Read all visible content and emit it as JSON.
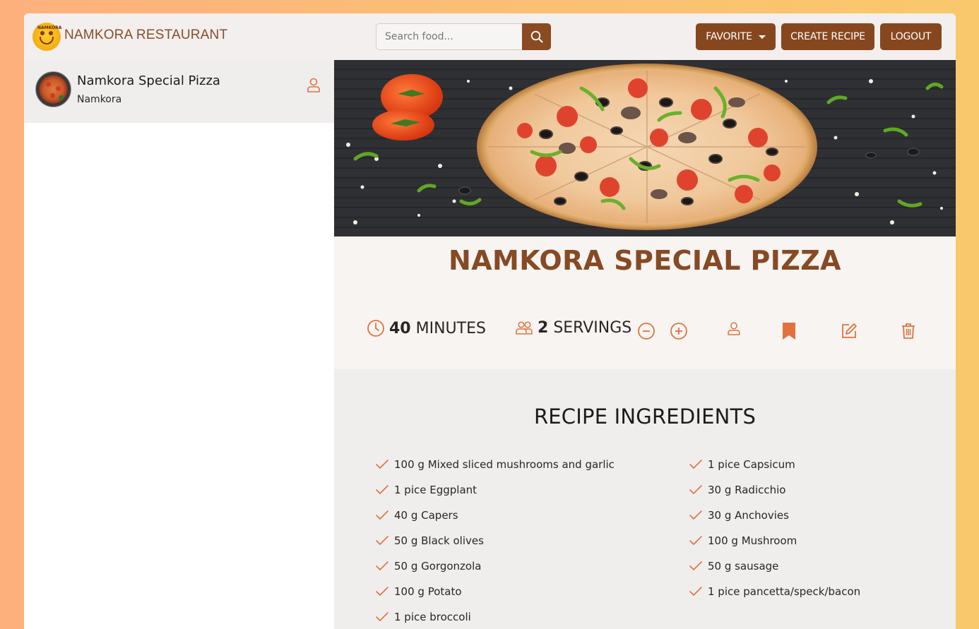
{
  "header": {
    "brand": "NAMKORA RESTAURANT",
    "search_placeholder": "Search food...",
    "favorite_label": "FAVORITE",
    "create_label": "CREATE RECIPE",
    "logout_label": "LOGOUT"
  },
  "sidebar": {
    "items": [
      {
        "title": "Namkora Special Pizza",
        "publisher": "Namkora"
      }
    ]
  },
  "recipe": {
    "title": "NAMKORA SPECIAL PIZZA",
    "minutes": "40",
    "minutes_label": "MINUTES",
    "servings": "2",
    "servings_label": "SERVINGS"
  },
  "ingredients": {
    "heading": "RECIPE INGREDIENTS",
    "left": [
      "100 g Mixed sliced mushrooms and garlic",
      "1 pice Eggplant",
      "40 g Capers",
      "50 g Black olives",
      "50 g Gorgonzola",
      "100 g Potato",
      "1 pice broccoli"
    ],
    "right": [
      "1 pice Capsicum",
      "30 g Radicchio",
      "30 g Anchovies",
      "100 g Mushroom",
      "50 g sausage",
      "1 pice pancetta/speck/bacon"
    ]
  },
  "colors": {
    "brand_brown": "#87471e",
    "accent_orange": "#e0733d",
    "title_brown": "#864a24"
  }
}
